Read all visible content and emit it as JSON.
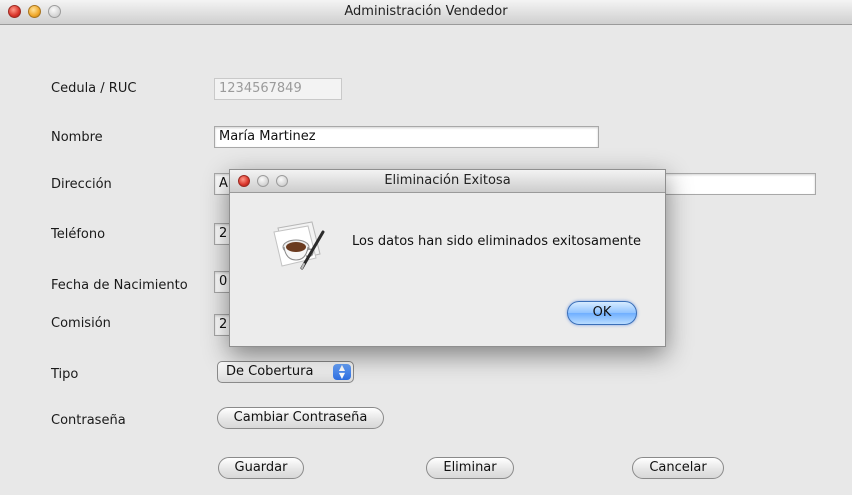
{
  "window": {
    "title": "Administración Vendedor"
  },
  "form": {
    "cedula_label": "Cedula / RUC",
    "cedula_value": "1234567849",
    "nombre_label": "Nombre",
    "nombre_value": "María Martinez",
    "direccion_label": "Dirección",
    "direccion_value": "A",
    "telefono_label": "Teléfono",
    "telefono_value": "2",
    "fecha_label": "Fecha de Nacimiento",
    "fecha_value": "0",
    "comision_label": "Comisión",
    "comision_value": "2",
    "tipo_label": "Tipo",
    "tipo_value": "De Cobertura",
    "contrasena_label": "Contraseña",
    "cambiar_contrasena": "Cambiar Contraseña"
  },
  "buttons": {
    "guardar": "Guardar",
    "eliminar": "Eliminar",
    "cancelar": "Cancelar"
  },
  "dialog": {
    "title": "Eliminación Exitosa",
    "message": "Los datos han sido eliminados exitosamente",
    "ok": "OK",
    "icon": "coffee-cup-pen-icon"
  },
  "colors": {
    "default_button": "#6fafff",
    "close_red": "#d9342a",
    "minimize_yellow": "#f0a82a"
  }
}
